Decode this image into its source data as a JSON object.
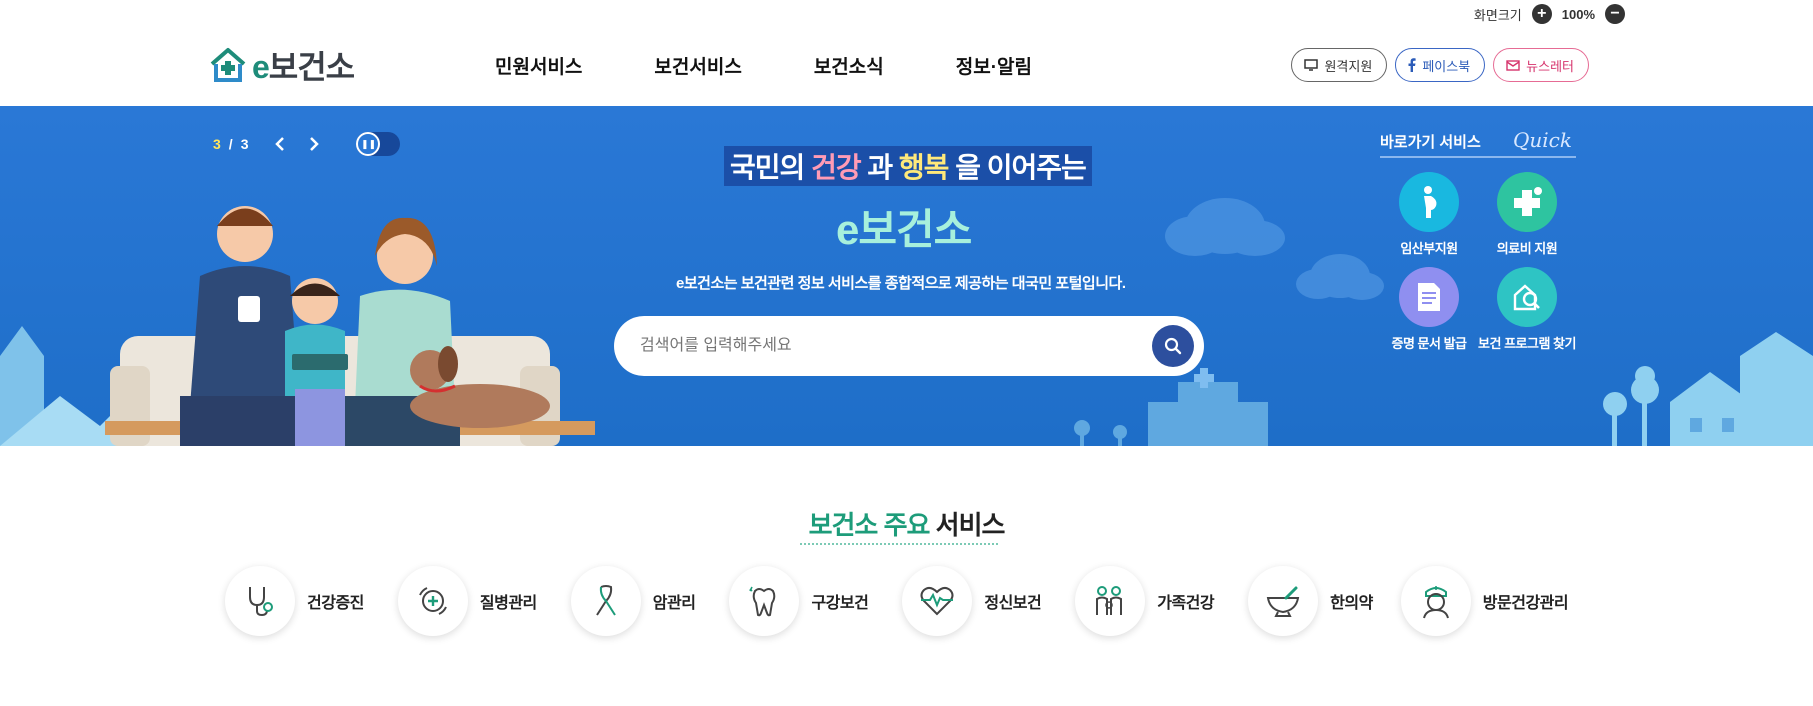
{
  "utility": {
    "zoom_label": "화면크기",
    "zoom_in": "+",
    "zoom_value": "100%",
    "zoom_out": "−"
  },
  "header": {
    "logo_e": "e",
    "logo_rest": "보건소",
    "nav": [
      "민원서비스",
      "보건서비스",
      "보건소식",
      "정보·알림"
    ],
    "buttons": {
      "remote": "원격지원",
      "facebook": "페이스북",
      "newsletter": "뉴스레터"
    }
  },
  "hero": {
    "slide_current": "3",
    "slide_sep": "/",
    "slide_total": "3",
    "title_1": "국민의 ",
    "title_health": "건강",
    "title_2": " 과 ",
    "title_happy": "행복",
    "title_3": " 을 이어주는",
    "subtitle": "e보건소",
    "description": "e보건소는 보건관련 정보 서비스를 종합적으로 제공하는 대국민 포털입니다.",
    "search_placeholder": "검색어를 입력해주세요"
  },
  "quick": {
    "title": "바로가기 서비스",
    "title_en": "Quick",
    "items": [
      {
        "label": "임산부지원",
        "icon": "pregnant-woman-icon",
        "color": "#19b8e0"
      },
      {
        "label": "의료비 지원",
        "icon": "medical-cross-icon",
        "color": "#2ec4a0"
      },
      {
        "label": "증명 문서 발급",
        "icon": "document-icon",
        "color": "#8f8ff0"
      },
      {
        "label": "보건 프로그램 찾기",
        "icon": "program-search-icon",
        "color": "#2ec4c4"
      }
    ]
  },
  "services": {
    "title_accent": "보건소 주요",
    "title_rest": " 서비스",
    "items": [
      {
        "label": "건강증진",
        "icon": "stethoscope-icon"
      },
      {
        "label": "질병관리",
        "icon": "disease-management-icon"
      },
      {
        "label": "암관리",
        "icon": "cancer-ribbon-icon"
      },
      {
        "label": "구강보건",
        "icon": "tooth-icon"
      },
      {
        "label": "정신보건",
        "icon": "heartbeat-icon"
      },
      {
        "label": "가족건강",
        "icon": "family-icon"
      },
      {
        "label": "한의약",
        "icon": "mortar-pestle-icon"
      },
      {
        "label": "방문건강관리",
        "icon": "nurse-icon"
      }
    ]
  },
  "colors": {
    "hero_blue": "#1e6ec8",
    "accent_green": "#1d9c7a",
    "search_button": "#2d4f9e"
  }
}
